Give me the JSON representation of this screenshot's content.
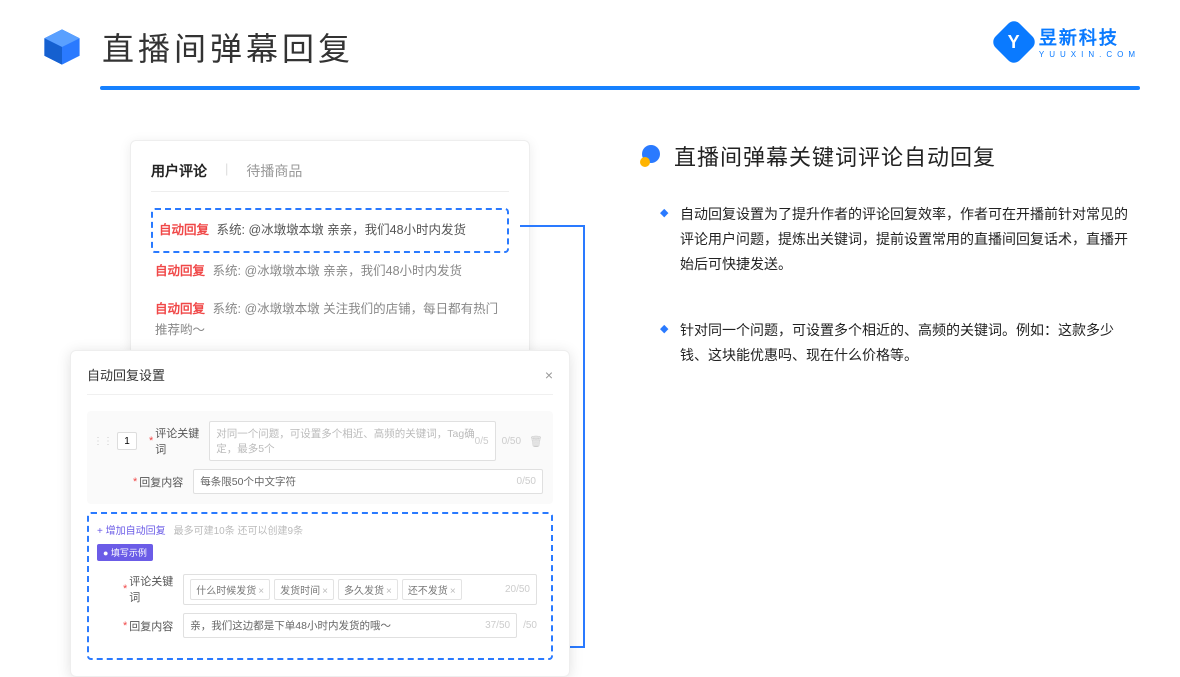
{
  "header": {
    "title": "直播间弹幕回复",
    "brand_cn": "昱新科技",
    "brand_en": "YUUXIN.COM"
  },
  "comment_card": {
    "tab_active": "用户评论",
    "tab_inactive": "待播商品",
    "rows": [
      {
        "tag": "自动回复",
        "sys": "系统:",
        "body": "@冰墩墩本墩 亲亲，我们48小时内发货"
      },
      {
        "tag": "自动回复",
        "sys": "系统:",
        "body": "@冰墩墩本墩 亲亲，我们48小时内发货"
      },
      {
        "tag": "自动回复",
        "sys": "系统:",
        "body": "@冰墩墩本墩 关注我们的店铺，每日都有热门推荐哟～"
      }
    ]
  },
  "settings": {
    "title": "自动回复设置",
    "idx": "1",
    "label_keyword": "评论关键词",
    "label_content": "回复内容",
    "keyword_placeholder": "对同一个问题，可设置多个相近、高频的关键词，Tag确定，最多5个",
    "keyword_counter": "0/5",
    "keyword_counter2": "0/50",
    "content_text": "每条限50个中文字符",
    "content_counter": "0/50",
    "add_link": "+ 增加自动回复",
    "add_note": "最多可建10条 还可以创建9条",
    "eg_badge": "● 填写示例",
    "eg_tags": [
      "什么时候发货",
      "发货时间",
      "多久发货",
      "还不发货"
    ],
    "eg_tag_counter": "20/50",
    "eg_content": "亲，我们这边都是下单48小时内发货的哦～",
    "eg_content_counter": "37/50",
    "trailing_counter": "/50"
  },
  "right": {
    "heading": "直播间弹幕关键词评论自动回复",
    "bullets": [
      "自动回复设置为了提升作者的评论回复效率，作者可在开播前针对常见的评论用户问题，提炼出关键词，提前设置常用的直播间回复话术，直播开始后可快捷发送。",
      "针对同一个问题，可设置多个相近的、高频的关键词。例如：这款多少钱、这块能优惠吗、现在什么价格等。"
    ]
  }
}
